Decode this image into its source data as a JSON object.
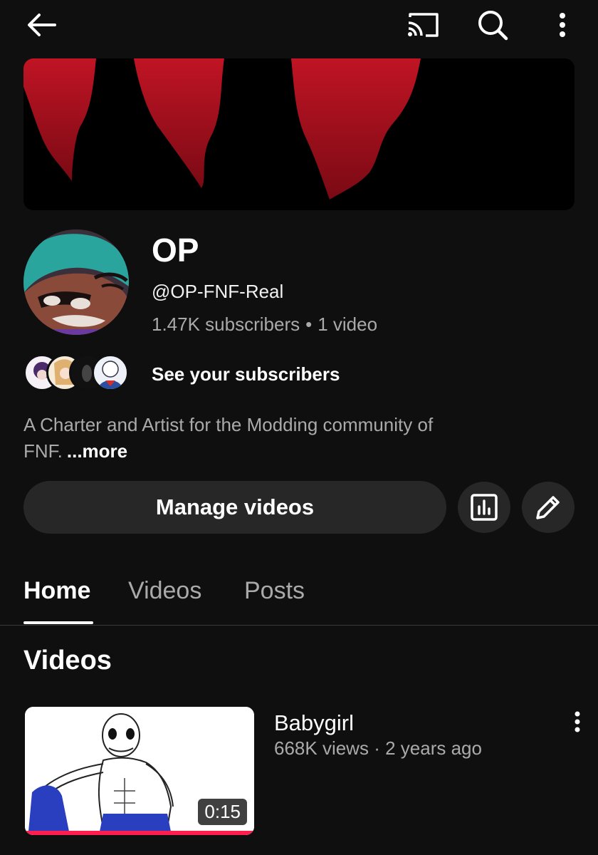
{
  "channel": {
    "name": "OP",
    "handle": "@OP-FNF-Real",
    "subscribers": "1.47K subscribers",
    "separator": "•",
    "video_count": "1 video",
    "see_subscribers": "See your subscribers",
    "description": "A Charter and Artist for the Modding community of FNF.",
    "more_label": "...more"
  },
  "actions": {
    "manage_videos": "Manage videos"
  },
  "tabs": [
    {
      "label": "Home",
      "active": true
    },
    {
      "label": "Videos",
      "active": false
    },
    {
      "label": "Posts",
      "active": false
    }
  ],
  "section": {
    "title": "Videos"
  },
  "videos": [
    {
      "title": "Babygirl",
      "views": "668K views",
      "meta_separator": "·",
      "age": "2 years ago",
      "duration": "0:15",
      "watched_fraction": 1.0
    }
  ],
  "icons": {
    "back": "arrow-left-icon",
    "cast": "cast-icon",
    "search": "search-icon",
    "more": "more-vert-icon",
    "analytics": "analytics-icon",
    "edit": "pencil-icon"
  },
  "colors": {
    "background": "#0f0f0f",
    "button": "#272727",
    "secondary_text": "#aaaaaa",
    "progress": "#ff1e4d"
  }
}
